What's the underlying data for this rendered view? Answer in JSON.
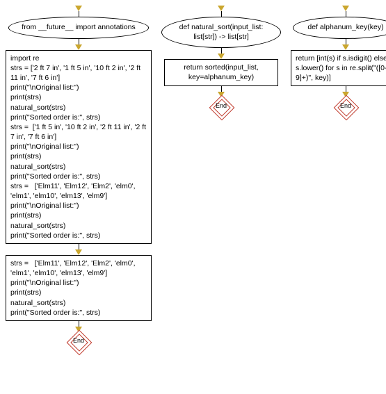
{
  "col1": {
    "start": "from __future__ import annotations",
    "box1": "import re\nstrs = ['2 ft 7 in', '1 ft 5 in', '10 ft 2 in', '2 ft 11 in', '7 ft 6 in']\nprint(\"\\nOriginal list:\")\nprint(strs)\nnatural_sort(strs)\nprint(\"Sorted order is:\", strs)\nstrs =  ['1 ft 5 in', '10 ft 2 in', '2 ft 11 in', '2 ft 7 in', '7 ft 6 in']\nprint(\"\\nOriginal list:\")\nprint(strs)\nnatural_sort(strs)\nprint(\"Sorted order is:\", strs)\nstrs =   ['Elm11', 'Elm12', 'Elm2', 'elm0', 'elm1', 'elm10', 'elm13', 'elm9']\nprint(\"\\nOriginal list:\")\nprint(strs)\nnatural_sort(strs)\nprint(\"Sorted order is:\", strs)",
    "box2": "strs =   ['Elm11', 'Elm12', 'Elm2', 'elm0', 'elm1', 'elm10', 'elm13', 'elm9']\nprint(\"\\nOriginal list:\")\nprint(strs)\nnatural_sort(strs)\nprint(\"Sorted order is:\", strs)",
    "end": "End"
  },
  "col2": {
    "start": "def natural_sort(input_list: list[str]) -> list[str]",
    "box": "return sorted(input_list, key=alphanum_key)",
    "end": "End"
  },
  "col3": {
    "start": "def alphanum_key(key)",
    "box": "return [int(s) if s.isdigit() else s.lower() for s in re.split(\"([0-9]+)\", key)]",
    "end": "End"
  }
}
